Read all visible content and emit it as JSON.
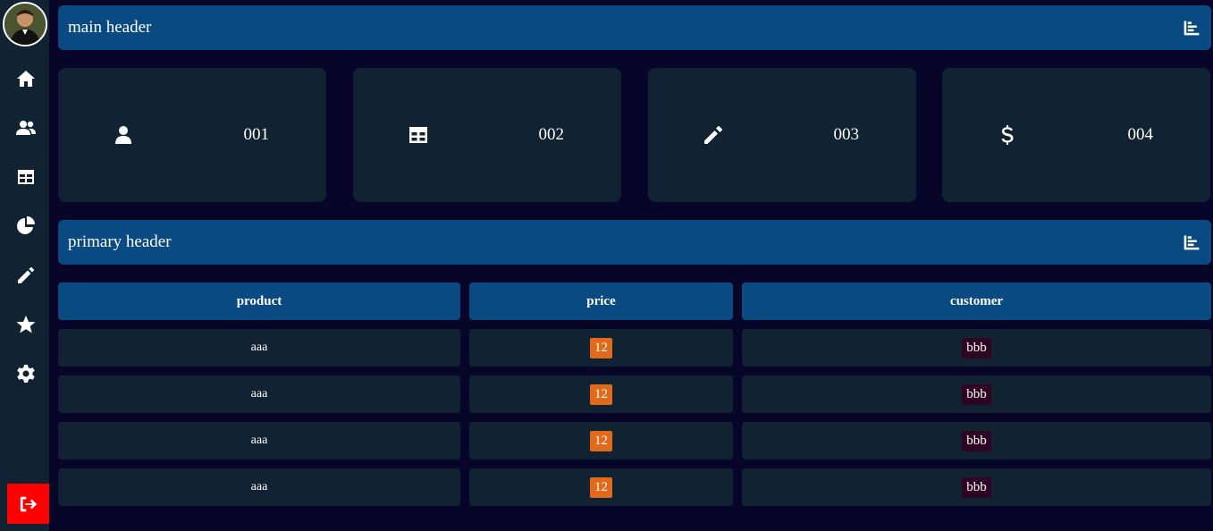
{
  "sidebar": {
    "avatar_icon": "user-avatar",
    "items": [
      {
        "name": "home",
        "icon": "home-icon"
      },
      {
        "name": "users",
        "icon": "users-icon"
      },
      {
        "name": "table",
        "icon": "table-icon"
      },
      {
        "name": "chart",
        "icon": "pie-chart-icon"
      },
      {
        "name": "edit",
        "icon": "pencil-icon"
      },
      {
        "name": "favorites",
        "icon": "star-icon"
      },
      {
        "name": "settings",
        "icon": "gear-icon"
      }
    ],
    "logout_icon": "logout-icon",
    "logout_color": "#ff0000"
  },
  "main_header": {
    "title": "main header",
    "icon": "chart-bar-icon"
  },
  "cards": [
    {
      "icon": "user-icon",
      "value": "001"
    },
    {
      "icon": "table-icon",
      "value": "002"
    },
    {
      "icon": "pencil-icon",
      "value": "003"
    },
    {
      "icon": "dollar-icon",
      "value": "004"
    }
  ],
  "primary_header": {
    "title": "primary header",
    "icon": "chart-bar-icon"
  },
  "table": {
    "columns": [
      "product",
      "price",
      "customer"
    ],
    "rows": [
      {
        "product": "aaa",
        "price": "12",
        "customer": "bbb"
      },
      {
        "product": "aaa",
        "price": "12",
        "customer": "bbb"
      },
      {
        "product": "aaa",
        "price": "12",
        "customer": "bbb"
      },
      {
        "product": "aaa",
        "price": "12",
        "customer": "bbb"
      }
    ]
  },
  "colors": {
    "background": "#070628",
    "panel": "#112232",
    "header": "#0a4a82",
    "price_badge": "#e06a1a",
    "customer_badge": "#2e0522"
  }
}
